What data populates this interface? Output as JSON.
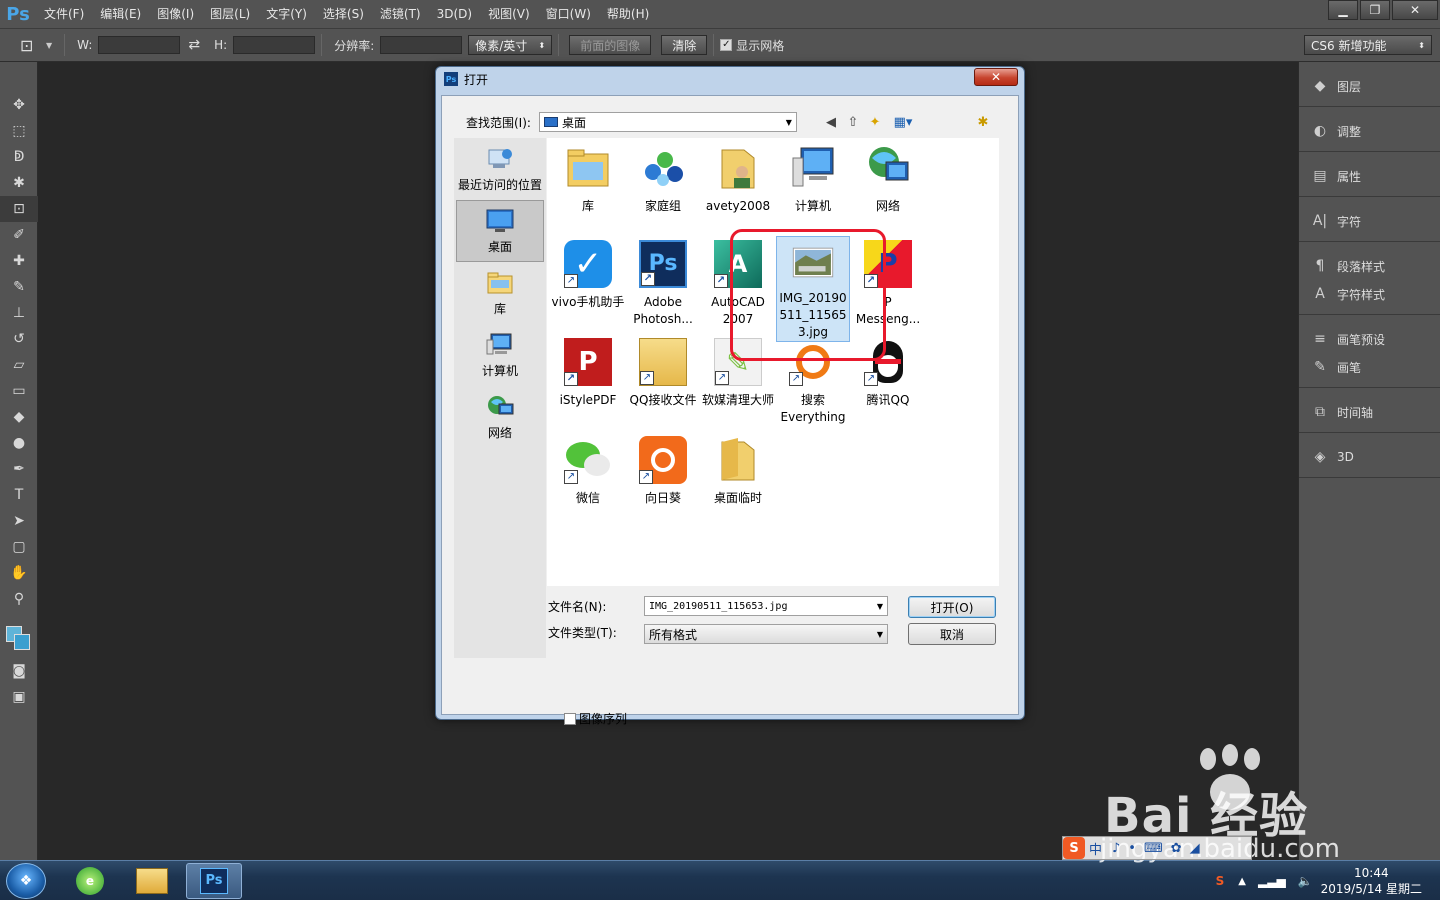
{
  "menubar": {
    "logo": "Ps",
    "items": [
      "文件(F)",
      "编辑(E)",
      "图像(I)",
      "图层(L)",
      "文字(Y)",
      "选择(S)",
      "滤镜(T)",
      "3D(D)",
      "视图(V)",
      "窗口(W)",
      "帮助(H)"
    ],
    "win_buttons": [
      "▁",
      "❐",
      "✕"
    ]
  },
  "optbar": {
    "w_label": "W:",
    "h_label": "H:",
    "resolution_label": "分辨率:",
    "unit_select": "像素/英寸",
    "front_image_btn": "前面的图像",
    "clear_btn": "清除",
    "show_grid_label": "显示网格",
    "workspace": "CS6 新增功能"
  },
  "rightdock": {
    "groups": [
      [
        {
          "icon": "◆",
          "label": "图层"
        }
      ],
      [
        {
          "icon": "◐",
          "label": "调整"
        }
      ],
      [
        {
          "icon": "▤",
          "label": "属性"
        }
      ],
      [
        {
          "icon": "A|",
          "label": "字符"
        }
      ],
      [
        {
          "icon": "¶",
          "label": "段落样式"
        },
        {
          "icon": "A",
          "label": "字符样式"
        }
      ],
      [
        {
          "icon": "≡",
          "label": "画笔预设"
        },
        {
          "icon": "✎",
          "label": "画笔"
        }
      ],
      [
        {
          "icon": "⧉",
          "label": "时间轴"
        }
      ],
      [
        {
          "icon": "◈",
          "label": "3D"
        }
      ]
    ]
  },
  "dialog": {
    "title": "打开",
    "close": "✕",
    "lookin_label": "查找范围(I):",
    "lookin_value": "桌面",
    "places": [
      "最近访问的位置",
      "桌面",
      "库",
      "计算机",
      "网络"
    ],
    "files": [
      {
        "label": "库"
      },
      {
        "label": "家庭组"
      },
      {
        "label": "avety2008"
      },
      {
        "label": "计算机"
      },
      {
        "label": "网络"
      },
      {
        "label": "vivo手机助手"
      },
      {
        "label": "Adobe Photosh..."
      },
      {
        "label": "AutoCAD 2007"
      },
      {
        "label": "IMG_20190511_115653.jpg"
      },
      {
        "label": "P Messeng..."
      },
      {
        "label": "iStylePDF"
      },
      {
        "label": "QQ接收文件"
      },
      {
        "label": "软媒清理大师"
      },
      {
        "label": "搜索 Everything"
      },
      {
        "label": "腾讯QQ"
      },
      {
        "label": "微信"
      },
      {
        "label": "向日葵"
      },
      {
        "label": "桌面临时"
      }
    ],
    "filename_label": "文件名(N):",
    "filename_value": "IMG_20190511_115653.jpg",
    "filetype_label": "文件类型(T):",
    "filetype_value": "所有格式",
    "open_btn": "打开(O)",
    "cancel_btn": "取消",
    "sequence_label": "图像序列"
  },
  "taskbar": {
    "ps_label": "Ps",
    "time": "10:44",
    "date": "2019/5/14 星期二"
  },
  "watermark": {
    "big": "Bai 经验",
    "small": "jingyan.baidu.com",
    "ime": "中"
  }
}
